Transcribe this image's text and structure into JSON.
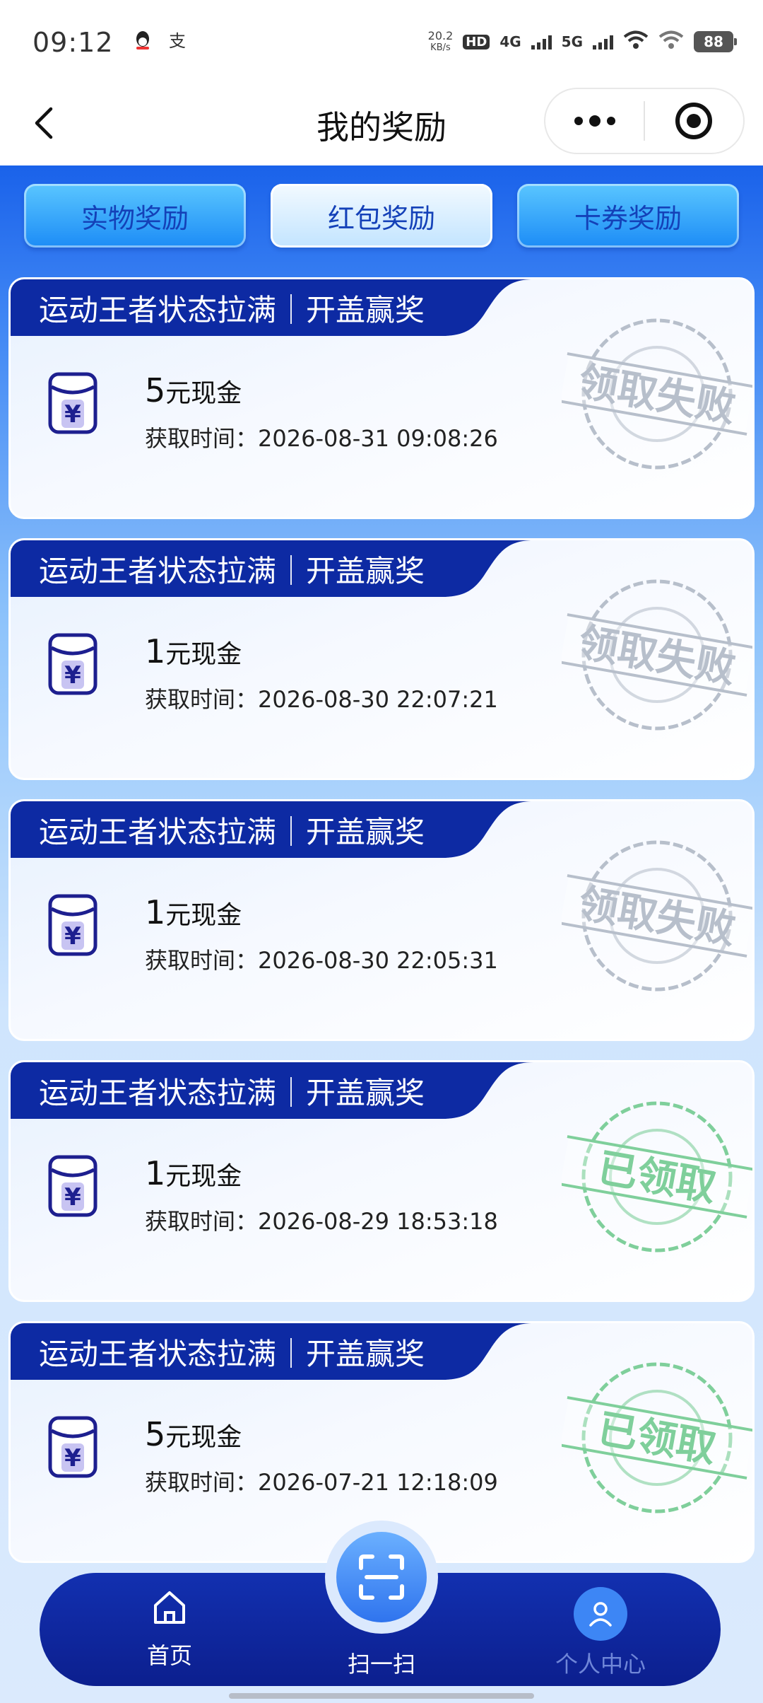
{
  "status_bar": {
    "time": "09:12",
    "net_speed_value": "20.2",
    "net_speed_unit": "KB/s",
    "hd_label": "HD",
    "signal_1": "4G",
    "signal_2": "5G",
    "battery": "88",
    "icons": [
      "qq-icon",
      "alipay-icon",
      "wifi-icon",
      "wifi-icon",
      "battery-icon"
    ]
  },
  "nav": {
    "title": "我的奖励",
    "back_icon": "chevron-left-icon",
    "more_icon": "more-dots-icon",
    "close_icon": "target-circle-icon"
  },
  "tabs": [
    {
      "label": "实物奖励",
      "active": false
    },
    {
      "label": "红包奖励",
      "active": true
    },
    {
      "label": "卡券奖励",
      "active": false
    }
  ],
  "cards": [
    {
      "title": "运动王者状态拉满｜开盖赢奖",
      "amount": "5",
      "unit": "元现金",
      "time_label": "获取时间：",
      "time": "2026-08-31 09:08:26",
      "stamp": "领取失败",
      "stamp_type": "failed"
    },
    {
      "title": "运动王者状态拉满｜开盖赢奖",
      "amount": "1",
      "unit": "元现金",
      "time_label": "获取时间：",
      "time": "2026-08-30 22:07:21",
      "stamp": "领取失败",
      "stamp_type": "failed"
    },
    {
      "title": "运动王者状态拉满｜开盖赢奖",
      "amount": "1",
      "unit": "元现金",
      "time_label": "获取时间：",
      "time": "2026-08-30 22:05:31",
      "stamp": "领取失败",
      "stamp_type": "failed"
    },
    {
      "title": "运动王者状态拉满｜开盖赢奖",
      "amount": "1",
      "unit": "元现金",
      "time_label": "获取时间：",
      "time": "2026-08-29 18:53:18",
      "stamp": "已领取",
      "stamp_type": "claimed"
    },
    {
      "title": "运动王者状态拉满｜开盖赢奖",
      "amount": "5",
      "unit": "元现金",
      "time_label": "获取时间：",
      "time": "2026-07-21 12:18:09",
      "stamp": "已领取",
      "stamp_type": "claimed"
    }
  ],
  "colors": {
    "header_blue": "#0d2aa3",
    "stamp_failed": "#b7bfcb",
    "stamp_claimed": "#7fcf9b",
    "nav_inactive": "#6f86d8"
  },
  "bottom_nav": {
    "home": {
      "label": "首页",
      "icon": "home-icon"
    },
    "scan": {
      "label": "扫一扫",
      "icon": "scan-icon"
    },
    "me": {
      "label": "个人中心",
      "icon": "user-icon"
    }
  }
}
